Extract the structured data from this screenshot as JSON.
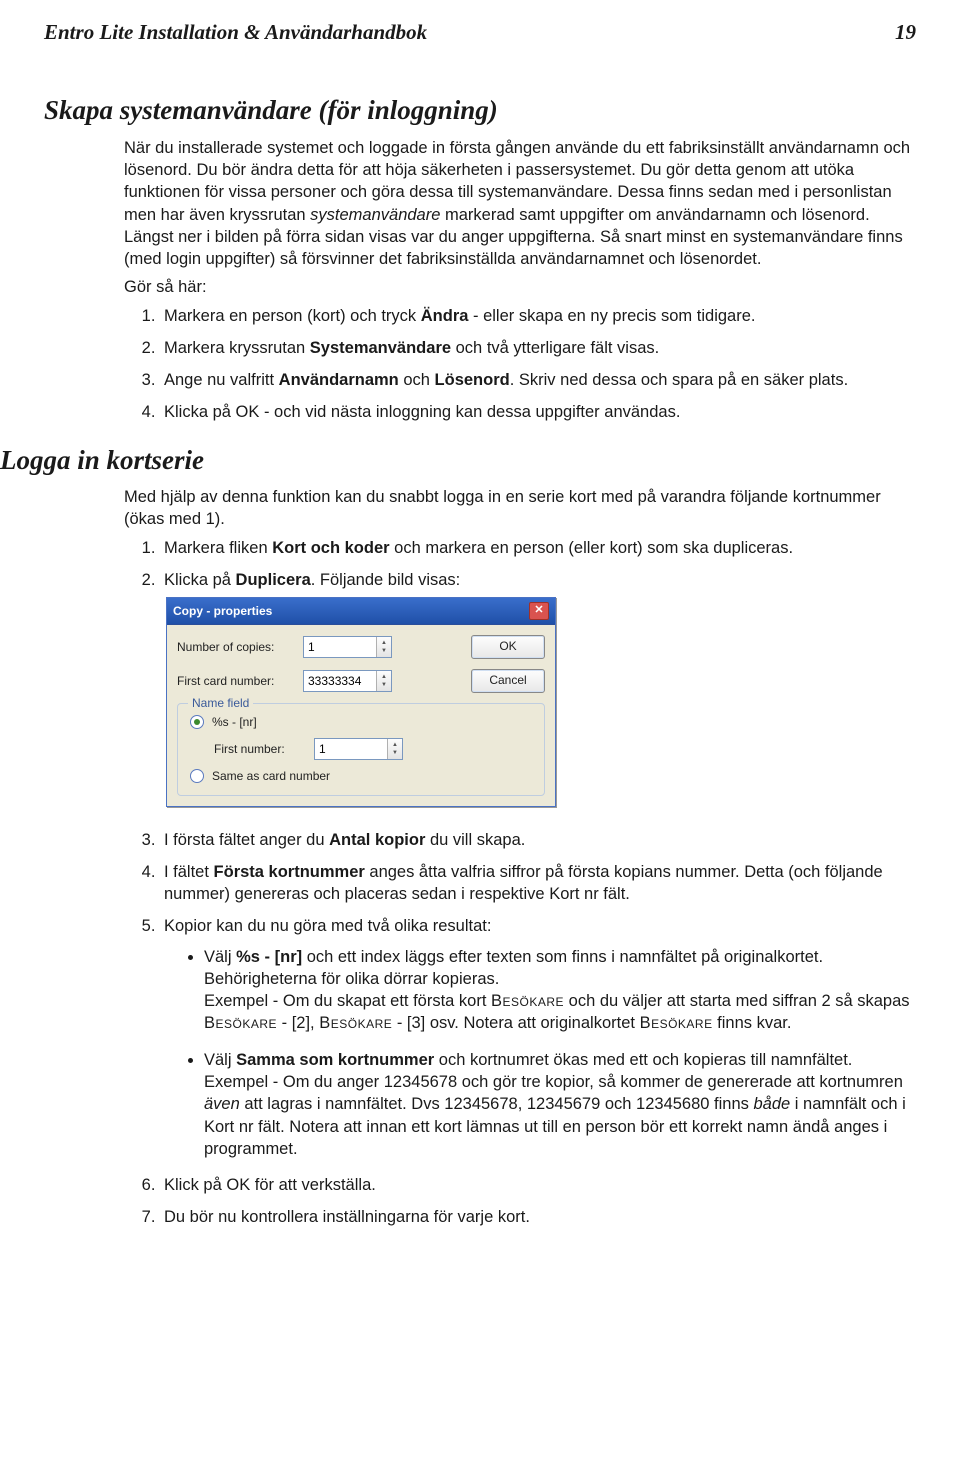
{
  "header": {
    "title": "Entro Lite Installation & Användarhandbok",
    "page": "19"
  },
  "s1": {
    "heading": "Skapa systemanvändare (för inloggning)",
    "p1a": "När du installerade systemet och loggade in första gången använde du ett fabriksinställt användarnamn och lösenord. Du bör ändra detta för att höja säkerheten i passersystemet. Du gör detta genom att utöka funktionen för vissa personer och göra dessa till systemanvändare. Dessa finns sedan med i personlistan men har även kryssrutan ",
    "p1b": "systemanvändare",
    "p1c": " markerad samt uppgifter om användarnamn och lösenord. Längst ner i bilden på förra sidan visas var du anger uppgifterna. Så snart minst en systemanvändare finns (med login uppgifter) så försvinner det fabriksinställda användarnamnet och lösenordet.",
    "p2": "Gör så här:",
    "li1a": "Markera en person (kort) och tryck ",
    "li1b": "Ändra",
    "li1c": " - eller skapa en ny precis som tidigare.",
    "li2a": "Markera kryssrutan ",
    "li2b": "Systemanvändare",
    "li2c": " och två ytterligare fält visas.",
    "li3a": "Ange nu valfritt ",
    "li3b": "Användarnamn",
    "li3c": " och ",
    "li3d": "Lösenord",
    "li3e": ". Skriv ned dessa och spara på en säker plats.",
    "li4": "Klicka på OK - och vid nästa inloggning kan dessa uppgifter användas."
  },
  "s2": {
    "heading": "Logga in kortserie",
    "p1": "Med hjälp av denna funktion kan du snabbt logga in en serie kort med på varandra följande kortnummer (ökas med 1).",
    "li1a": "Markera fliken ",
    "li1b": "Kort och koder",
    "li1c": " och markera en person (eller kort) som ska dupliceras.",
    "li2a": "Klicka på ",
    "li2b": "Duplicera",
    "li2c": ". Följande bild visas:",
    "li3a": "I första fältet anger du ",
    "li3b": "Antal kopior",
    "li3c": " du vill skapa.",
    "li4a": "I fältet ",
    "li4b": "Första kortnummer",
    "li4c": " anges åtta valfria siffror på första kopians nummer. Detta (och följande nummer) genereras och placeras sedan i respektive Kort nr fält.",
    "li5": "Kopior kan du nu göra med två olika resultat:",
    "b1a": "Välj ",
    "b1b": "%s - [nr]",
    "b1c": " och ett index läggs efter texten som finns i namnfältet på originalkortet. Behörigheterna för olika dörrar kopieras.",
    "b1d": "Exempel - Om du skapat ett första kort ",
    "b1e": "Besökare",
    "b1f": " och du väljer att starta med siffran 2 så skapas ",
    "b1g": "Besökare",
    "b1h": " - [2], ",
    "b1i": "Besökare",
    "b1j": " - [3] osv. Notera att originalkortet ",
    "b1k": "Besökare",
    "b1l": " finns kvar.",
    "b2a": "Välj ",
    "b2b": "Samma som kortnummer",
    "b2c": " och kortnumret ökas med ett och kopieras till namnfältet.",
    "b2d": "Exempel - Om du anger 12345678 och gör tre kopior, så kommer de genererade att kortnumren ",
    "b2e": "även",
    "b2f": " att lagras i namnfältet. Dvs 12345678, 12345679 och 12345680 finns ",
    "b2g": "både",
    "b2h": " i namnfält och i Kort nr fält. Notera att innan ett kort lämnas ut till en person bör ett korrekt namn ändå anges i programmet.",
    "li6": "Klick på OK för att verkställa.",
    "li7": "Du bör nu kontrollera inställningarna för varje kort."
  },
  "dialog": {
    "title": "Copy - properties",
    "copies_label": "Number of copies:",
    "copies_value": "1",
    "first_card_label": "First card number:",
    "first_card_value": "33333334",
    "ok": "OK",
    "cancel": "Cancel",
    "fieldset": "Name field",
    "radio1": "%s - [nr]",
    "first_number_label": "First number:",
    "first_number_value": "1",
    "radio2": "Same as card number"
  }
}
